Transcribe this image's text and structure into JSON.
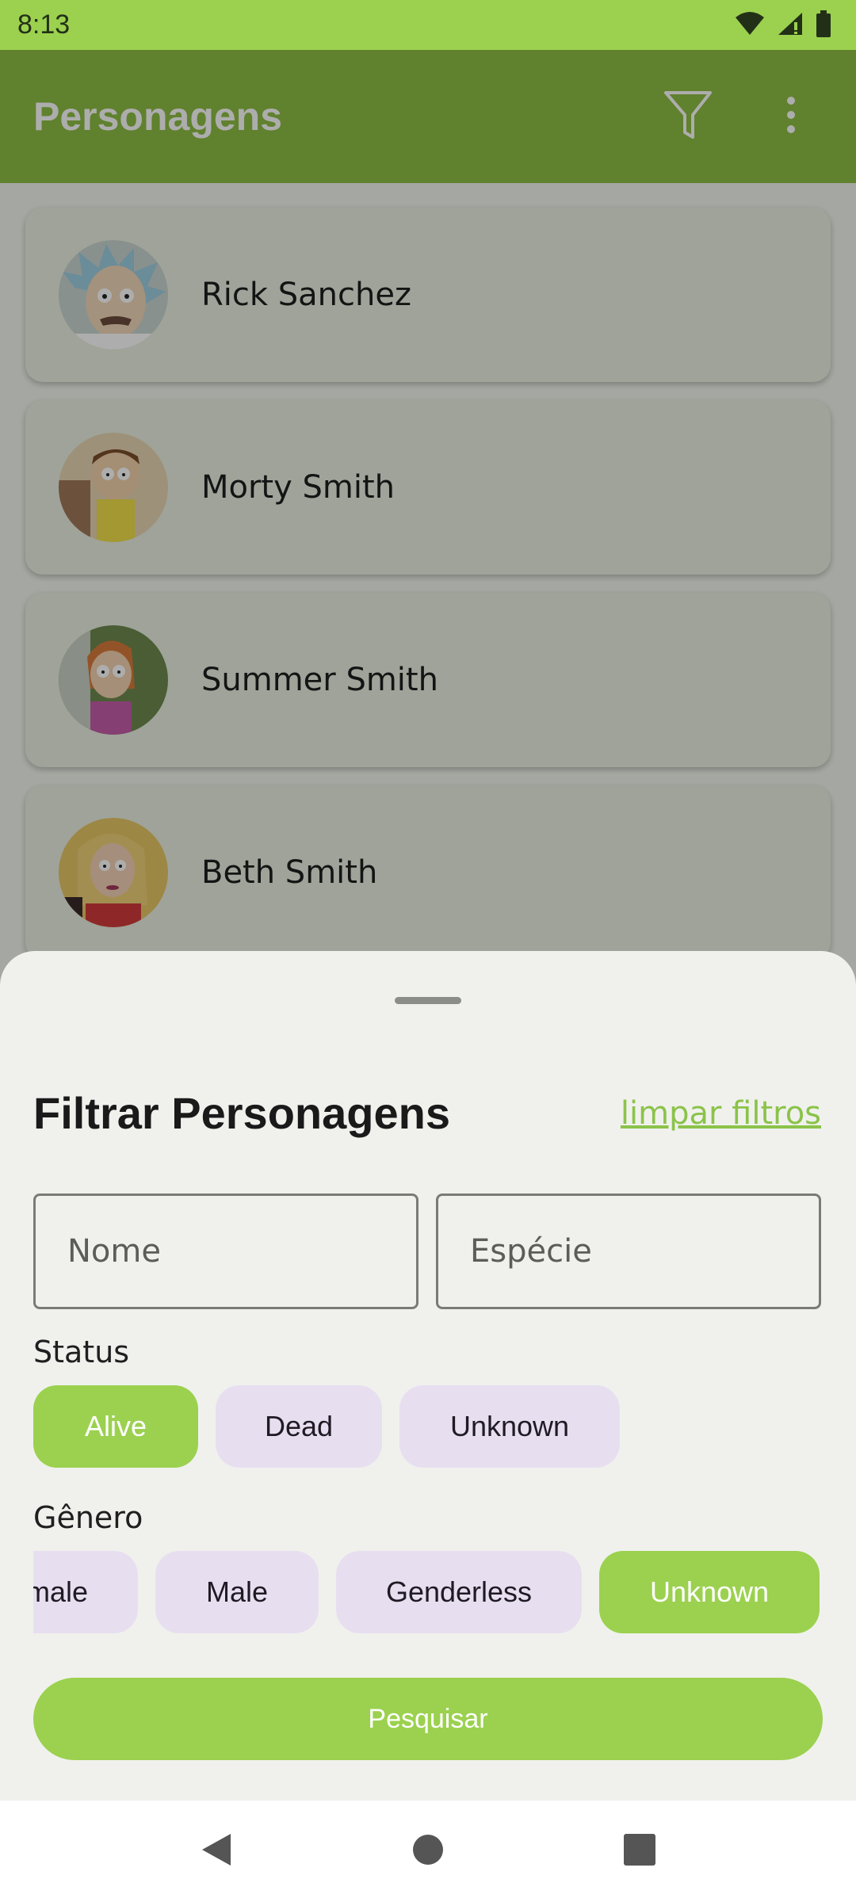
{
  "status_bar": {
    "time": "8:13",
    "icons": [
      "wifi-icon",
      "signal-icon",
      "battery-icon"
    ]
  },
  "app_bar": {
    "title": "Personagens",
    "actions": [
      "filter-icon",
      "more-vert-icon"
    ]
  },
  "characters": [
    {
      "name": "Rick Sanchez",
      "avatar": "rick-avatar"
    },
    {
      "name": "Morty Smith",
      "avatar": "morty-avatar"
    },
    {
      "name": "Summer Smith",
      "avatar": "summer-avatar"
    },
    {
      "name": "Beth Smith",
      "avatar": "beth-avatar"
    }
  ],
  "filter_sheet": {
    "title": "Filtrar Personagens",
    "clear_label": "limpar filtros",
    "name_placeholder": "Nome",
    "species_placeholder": "Espécie",
    "status_label": "Status",
    "status_options": [
      {
        "label": "Alive",
        "selected": true
      },
      {
        "label": "Dead",
        "selected": false
      },
      {
        "label": "Unknown",
        "selected": false
      }
    ],
    "gender_label": "Gênero",
    "gender_options": [
      {
        "label": "Female",
        "selected": false
      },
      {
        "label": "Male",
        "selected": false
      },
      {
        "label": "Genderless",
        "selected": false
      },
      {
        "label": "Unknown",
        "selected": true
      }
    ],
    "search_label": "Pesquisar"
  },
  "colors": {
    "accent": "#9bd14f",
    "app_bar": "#8ebf45",
    "chip_unselected": "#e7dff0"
  },
  "nav_bar": {
    "buttons": [
      "back-icon",
      "home-icon",
      "recents-icon"
    ]
  }
}
